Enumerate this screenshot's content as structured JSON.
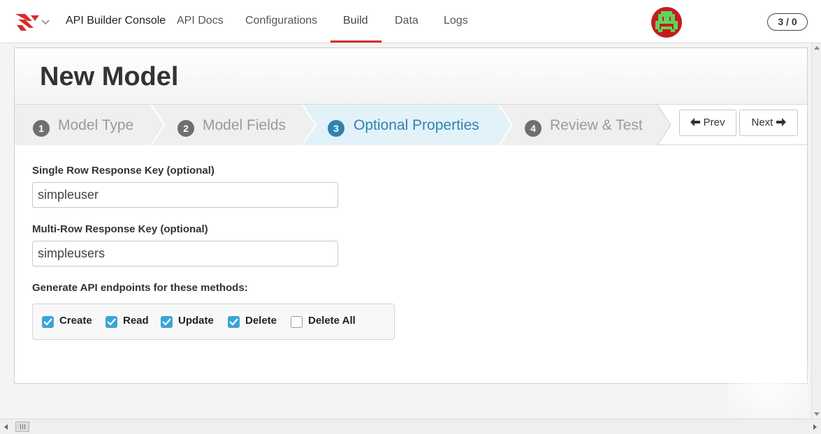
{
  "nav": {
    "brand": "API Builder Console",
    "items": [
      {
        "label": "API Docs"
      },
      {
        "label": "Configurations"
      },
      {
        "label": "Build"
      },
      {
        "label": "Data"
      },
      {
        "label": "Logs"
      }
    ],
    "active": "Build",
    "counter": "3 / 0"
  },
  "page": {
    "title": "New Model"
  },
  "wizard": {
    "steps": [
      {
        "num": "1",
        "label": "Model Type"
      },
      {
        "num": "2",
        "label": "Model Fields"
      },
      {
        "num": "3",
        "label": "Optional Properties"
      },
      {
        "num": "4",
        "label": "Review & Test"
      }
    ],
    "active_step": "3",
    "prev_label": "Prev",
    "next_label": "Next"
  },
  "form": {
    "single_key_label": "Single Row Response Key (optional)",
    "single_key_value": "simpleuser",
    "multi_key_label": "Multi-Row Response Key (optional)",
    "multi_key_value": "simpleusers",
    "methods_label": "Generate API endpoints for these methods:",
    "methods": [
      {
        "label": "Create",
        "checked": true
      },
      {
        "label": "Read",
        "checked": true
      },
      {
        "label": "Update",
        "checked": true
      },
      {
        "label": "Delete",
        "checked": true
      },
      {
        "label": "Delete All",
        "checked": false
      }
    ]
  },
  "colors": {
    "accent": "#d62c2c",
    "active_step": "#2e84b0",
    "checkbox": "#3aa5d8"
  },
  "icons": [
    "logo-icon",
    "chevron-down-icon",
    "avatar-icon",
    "arrow-left-icon",
    "arrow-right-icon",
    "check-icon"
  ]
}
